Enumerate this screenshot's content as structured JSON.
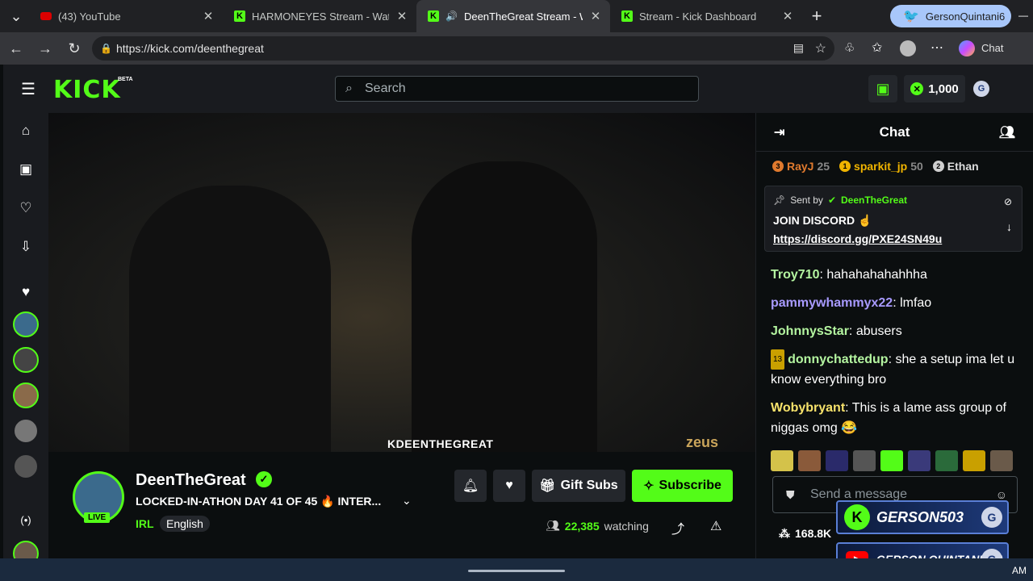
{
  "browser": {
    "tabs": [
      {
        "title": "(43) YouTube",
        "close": "✕",
        "favicon": "youtube-icon"
      },
      {
        "title": "HARMONEYES Stream - Watch Liv",
        "close": "✕",
        "favicon": "kick-icon"
      },
      {
        "title": "DeenTheGreat Stream - Watc",
        "close": "✕",
        "favicon": "kick-icon"
      },
      {
        "title": "Stream - Kick Dashboard",
        "close": "✕",
        "favicon": "kick-icon"
      }
    ],
    "new_tab": "+",
    "url": "https://kick.com/deenthegreat",
    "account_name": "GersonQuintani6",
    "copilot_label": "Chat"
  },
  "kick": {
    "logo": "KICK",
    "beta": "BETA",
    "search_placeholder": "Search",
    "points": "1,000"
  },
  "channel": {
    "name": "DeenTheGreat",
    "live_badge": "LIVE",
    "title": "LOCKED-IN-ATHON DAY 41 OF 45 🔥 INTER...",
    "category": "IRL",
    "language": "English",
    "gift_subs": "Gift Subs",
    "subscribe": "Subscribe",
    "viewers": "22,385",
    "watching_label": "watching",
    "watermark_left": "KDEENTHEGREAT",
    "watermark_right": "zeus"
  },
  "chat": {
    "title": "Chat",
    "leaderboard": [
      {
        "rank": "3",
        "name": "RayJ",
        "count": "25",
        "color": "#e07a2e"
      },
      {
        "rank": "1",
        "name": "sparkit_jp",
        "count": "50",
        "color": "#f0b400"
      },
      {
        "rank": "2",
        "name": "Ethan",
        "count": "",
        "color": "#cfcfcf"
      }
    ],
    "pinned": {
      "sent_by": "Sent by",
      "sender": "DeenTheGreat",
      "text": "JOIN DISCORD ☝",
      "link": "https://discord.gg/PXE24SN49u"
    },
    "messages": [
      {
        "user": "Troy710",
        "color": "#b4f5a0",
        "text": "hahahahahahhha"
      },
      {
        "user": "pammywhammyx22",
        "color": "#a89aff",
        "text": "lmfao"
      },
      {
        "user": "JohnnysStar",
        "color": "#b4f5a0",
        "text": "abusers"
      },
      {
        "user": "donnychattedup",
        "color": "#b4f5a0",
        "text": "she a setup ima let u know everything bro",
        "badge": "13"
      },
      {
        "user": "Wobybryant",
        "color": "#f7e26b",
        "text": "This is a lame ass group of niggas omg 😂"
      }
    ],
    "send_placeholder": "Send a message",
    "footer_count": "168.8K"
  },
  "overlay": {
    "kick_name": "GERSON503",
    "yt_name": "GERSON QUINTANILLA"
  },
  "taskbar": {
    "clock": "AM"
  }
}
